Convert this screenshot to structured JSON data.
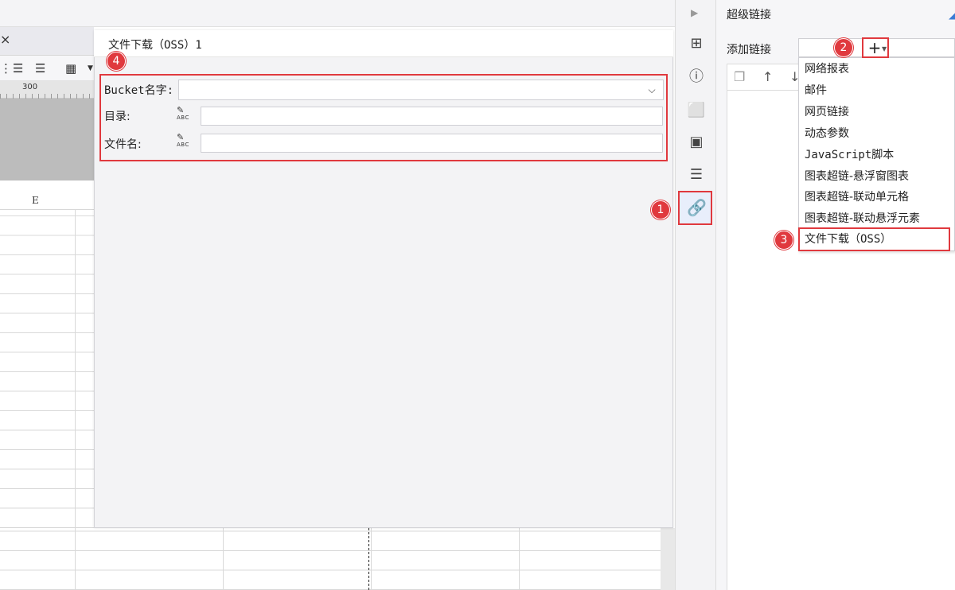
{
  "spreadsheet": {
    "ruler_label": "300",
    "column_header": "E",
    "tab_close": "×"
  },
  "dialog": {
    "title": "文件下载（OSS）1",
    "fields": [
      {
        "label": "Bucket名字:",
        "value": "",
        "type": "dropdown"
      },
      {
        "label": "目录:",
        "value": "",
        "type": "formula-input"
      },
      {
        "label": "文件名:",
        "value": "",
        "type": "formula-input"
      }
    ],
    "formula_icon_text": "ABC"
  },
  "panel": {
    "title": "超级链接",
    "add_label": "添加链接",
    "add_button": "+",
    "menu_items": [
      "网络报表",
      "邮件",
      "网页链接",
      "动态参数",
      "JavaScript脚本",
      "图表超链-悬浮窗图表",
      "图表超链-联动单元格",
      "图表超链-联动悬浮元素",
      "文件下载（OSS）"
    ]
  },
  "annotations": {
    "badge_1": "1",
    "badge_2": "2",
    "badge_3": "3",
    "badge_4": "4",
    "color": "#e0393e"
  }
}
